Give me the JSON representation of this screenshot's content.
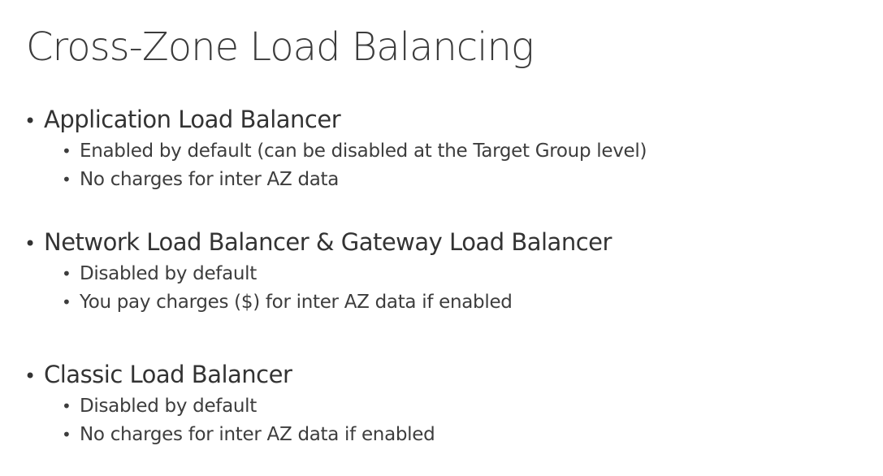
{
  "slide": {
    "title": "Cross-Zone Load Balancing",
    "sections": [
      {
        "heading": "Application Load Balancer",
        "items": [
          "Enabled by default (can be disabled at the Target Group level)",
          "No charges for inter AZ data"
        ]
      },
      {
        "heading": "Network Load Balancer & Gateway Load Balancer",
        "items": [
          "Disabled by default",
          "You pay charges ($) for inter AZ data if enabled"
        ]
      },
      {
        "heading": "Classic Load Balancer",
        "items": [
          "Disabled by default",
          "No charges for inter AZ data if enabled"
        ]
      }
    ]
  }
}
